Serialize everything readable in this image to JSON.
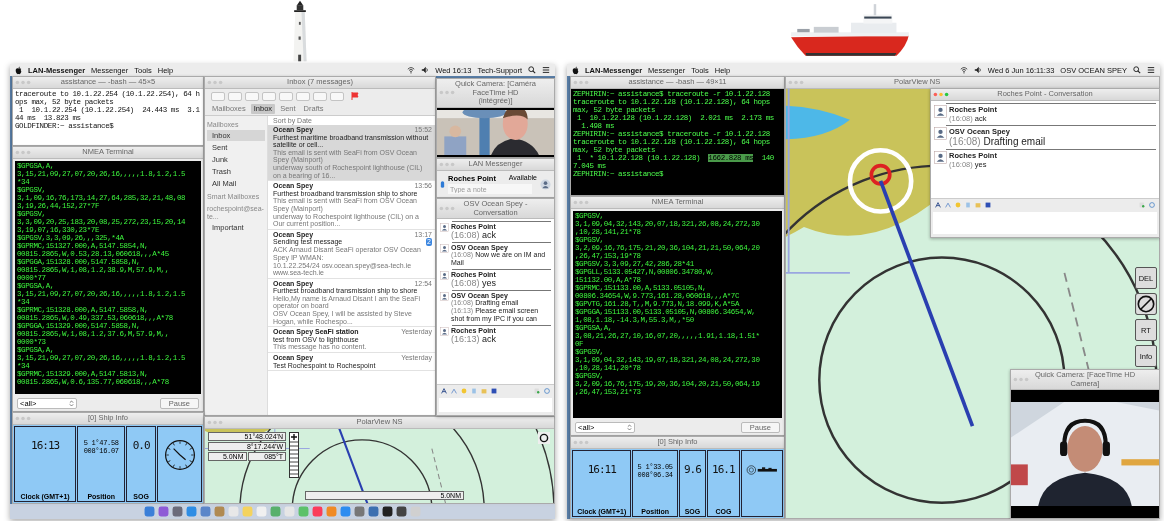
{
  "left_screen": {
    "menu_bar": {
      "app": "LAN-Messenger",
      "menus": [
        "Messenger",
        "Tools",
        "Help"
      ],
      "clock": "Wed 16:13",
      "user": "Tech-Support"
    },
    "terminal": {
      "title": "assistance — -bash — 45×5",
      "dark": false,
      "lines": [
        "traceroute to 10.1.22.254 (10.1.22.254), 64 h",
        "ops max, 52 byte packets",
        " 1  10.1.22.254 (10.1.22.254)  24.443 ms  3.1",
        "44 ms  13.823 ms",
        "GOLDFINDER:~ assistance$"
      ]
    },
    "nmea_terminal": {
      "title": "NMEA Terminal",
      "filter": "<all>",
      "button": "Pause",
      "lines": [
        "$GPGSA,A,",
        "3,15,21,09,27,07,20,26,16,,,,,1.8,1.2,1.5",
        "*34",
        "$GPGSV,",
        "3,1,09,16,76,173,14,27,64,285,32,21,48,08",
        "3,19,26,44,152,27*7F",
        "$GPGSV,",
        "3,3,09,20,25,183,20,08,25,272,23,15,20,14",
        "3,19,07,16,330,23*7E",
        "$GPGSV,3,3,09,26,,,325,*4A",
        "$GPRMC,151327.000,A,5147.5854,N,",
        "00815.2865,W,0.53,28.13,060618,,,A*45",
        "$GPGGA,151328.000,5147.5858,N,",
        "00815.2865,W,1,08,1.2,38.9,M,57.9,M,,",
        "0000*77",
        "$GPGSA,A,",
        "3,15,21,09,27,07,20,26,16,,,,,1.8,1.2,1.5",
        "*34",
        "$GPRMC,151328.000,A,5147.5858,N,",
        "00815.2865,W,0.49,337.53,060618,,,A*78",
        "$GPGGA,151329.000,5147.5858,N,",
        "00815.2865,W,1,08,1.2,37.6,M,57.9,M,,",
        "0000*73",
        "$GPGSA,A,",
        "3,15,21,09,27,07,20,26,16,,,,,1.8,1.2,1.5",
        "*34",
        "$GPRMC,151329.000,A,5147.5813,N,",
        "00815.2865,W,0.6,135.77,060618,,,A*78"
      ]
    },
    "mail": {
      "title": "Inbox (7 messages)",
      "tabs": [
        {
          "label": "Mailboxes",
          "selected": false
        },
        {
          "label": "Inbox",
          "selected": true
        },
        {
          "label": "Sent",
          "selected": false
        },
        {
          "label": "Drafts",
          "selected": false
        }
      ],
      "sidebar": {
        "heading": "Mailboxes",
        "items": [
          {
            "label": "Inbox",
            "selected": true
          },
          {
            "label": "Sent",
            "selected": false
          },
          {
            "label": "Junk",
            "selected": false
          },
          {
            "label": "Trash",
            "selected": false
          },
          {
            "label": "All Mail",
            "selected": false
          }
        ],
        "smart_heading": "Smart Mailboxes",
        "account": "rochespoint@sea-te...",
        "account_items": [
          {
            "label": "Important",
            "selected": false
          }
        ]
      },
      "sort": "Sort by Date",
      "messages": [
        {
          "sender": "Ocean Spey",
          "time": "15:52",
          "subject": "Furthest maritime broadband transmission without satellite or cell...",
          "preview": [
            "This email is sent with SeaFi from OSV Ocean Spey (Mainport)",
            "underway south of Rochespoint lighthouse (CIL) on a bearing of 16..."
          ],
          "selected": true
        },
        {
          "sender": "Ocean Spey",
          "time": "13:56",
          "subject": "Furthest broadband transmission ship to shore",
          "preview": [
            "This email is sent with SeaFi from OSV Ocean Spey (Mainport)",
            "underway to Rochespoint lighthouse (CIL) on a Our current position..."
          ],
          "selected": false
        },
        {
          "sender": "Ocean Spey",
          "time": "13:17",
          "subject": "Sending test message",
          "preview": [
            "ACK Arnaud Disant SeaFi operator OSV Ocean Spey IP WMAN:",
            "10.1.22.254/24 osv.ocean.spey@sea-tech.ie www.sea-tech.ie"
          ],
          "thread_count": "2",
          "selected": false
        },
        {
          "sender": "Ocean Spey",
          "time": "12:54",
          "subject": "Furthest broadband transmission ship to shore",
          "preview": [
            "Hello,My name is Arnaud Disant I am the SeaFi operator on board",
            "OSV Ocean Spey, I will be assisted by Steve Hogan, while Rochespo..."
          ],
          "selected": false
        },
        {
          "sender": "Ocean Spey SeaFi station",
          "time": "Yesterday",
          "subject": "test from OSV to lighthouse",
          "preview": [
            "This message has no content."
          ],
          "selected": false
        },
        {
          "sender": "Ocean Spey",
          "time": "Yesterday",
          "subject": "Test Rochespoint to Rochespoint",
          "selected": false
        }
      ]
    },
    "camera": {
      "title": "Quick Camera: [Caméra FaceTime HD (intégrée)]"
    },
    "messenger": {
      "title": "LAN Messenger",
      "contact": "Roches Point",
      "status": "Available",
      "note_placeholder": "Type a note"
    },
    "conversation": {
      "title": "OSV Ocean Spey - Conversation",
      "messages": [
        {
          "sender": "Roches Point",
          "lines": [
            {
              "time": "(16:08)",
              "text": "ack",
              "kind": "big"
            }
          ]
        },
        {
          "sender": "OSV Ocean Spey",
          "lines": [
            {
              "time": "(16:08)",
              "text": "Now we are on IM and Mail",
              "kind": "plain"
            }
          ]
        },
        {
          "sender": "Roches Point",
          "lines": [
            {
              "time": "(16:08)",
              "text": "yes",
              "kind": "big"
            }
          ]
        },
        {
          "sender": "OSV Ocean Spey",
          "lines": [
            {
              "time": "(16:08)",
              "text": "Drafting email",
              "kind": "plain"
            },
            {
              "time": "(16:13)",
              "text": "Please email screen shot from my IPC if you can",
              "kind": "plain"
            }
          ]
        },
        {
          "sender": "Roches Point",
          "lines": [
            {
              "time": "(16:13)",
              "text": "ack",
              "kind": "big"
            }
          ]
        }
      ]
    },
    "ship_info": {
      "title": "[0] Ship Info",
      "panels": [
        {
          "kind": "digits",
          "value": "16:13",
          "label": "Clock (GMT+1)"
        },
        {
          "kind": "position",
          "lines": [
            "5 1°47.58",
            "008°16.07"
          ],
          "label": "Position"
        },
        {
          "kind": "digits",
          "value": "0.0",
          "label": "SOG"
        },
        {
          "kind": "dial"
        }
      ]
    },
    "chart": {
      "title": "PolarView NS",
      "readouts": [
        "51°48.024'N",
        "8°17.244'W",
        "5.0NM",
        "085°T"
      ],
      "scale": "5.0NM"
    }
  },
  "right_screen": {
    "menu_bar": {
      "app": "LAN-Messenger",
      "menus": [
        "Messenger",
        "Tools",
        "Help"
      ],
      "clock": "Wed 6 Jun 16:11:33",
      "user": "OSV OCEAN SPEY"
    },
    "terminal": {
      "title": "assistance — -bash — 49×11",
      "dark": true,
      "lines": [
        "ZEPHIRIN:~ assistance$ traceroute -r 10.1.22.128",
        "traceroute to 10.1.22.128 (10.1.22.128), 64 hops",
        "max, 52 byte packets",
        " 1  10.1.22.128 (10.1.22.128)  2.021 ms  2.173 ms",
        "  1.498 ms",
        "ZEPHIRIN:~ assistance$ traceroute -r 10.1.22.128",
        "traceroute to 10.1.22.128 (10.1.22.128), 64 hops",
        "max, 52 byte packets",
        {
          "before": " 1  * 10.1.22.128 (10.1.22.128)  ",
          "highlight": "1662.828 ms",
          "after": "  140"
        },
        "7.045 ms",
        "ZEPHIRIN:~ assistance$"
      ]
    },
    "nmea_terminal": {
      "title": "NMEA Terminal",
      "filter": "<all>",
      "button": "Pause",
      "lines": [
        "$GPGSV,",
        "3,1,09,04,32,143,20,07,18,321,26,08,24,272,30",
        ",10,28,141,21*78",
        "$GPGSV,",
        "3,2,09,16,76,175,21,20,36,104,21,21,50,064,20",
        ",26,47,153,19*78",
        "$GPGSV,3,3,09,27,42,286,28*41",
        "$GPGLL,5133.05427,N,00806.34780,W,",
        "151132.00,A,A*78",
        "$GPRMC,151133.00,A,5133.05105,N,",
        "00806.34654,W,9.773,161.28,060618,,,A*7C",
        "$GPVTG,161.28,T,,M,9.773,N,18.099,K,A*5A",
        "$GPGGA,151133.00,5133.05105,N,00806.34654,W,",
        "1,08,1.18,-14.3,M,55.3,M,,*50",
        "$GPGSA,A,",
        "3,08,21,26,27,10,16,07,20,,,,,1.91,1.18,1.51*",
        "0F",
        "$GPGSV,",
        "3,1,09,04,32,143,19,07,18,321,24,08,24,272,30",
        ",10,28,141,20*78",
        "$GPGSV,",
        "3,2,09,16,76,175,19,20,36,104,20,21,50,064,19",
        ",26,47,153,21*73"
      ]
    },
    "ship_info": {
      "title": "[0] Ship Info",
      "panels": [
        {
          "kind": "digits",
          "value": "16:11",
          "label": "Clock (GMT+1)"
        },
        {
          "kind": "position",
          "lines": [
            "5 1°33.05",
            "008°06.34"
          ],
          "label": "Position"
        },
        {
          "kind": "digits",
          "value": "9.6",
          "label": "SOG"
        },
        {
          "kind": "digits",
          "value": "16.1",
          "label": "COG"
        },
        {
          "kind": "gauge"
        }
      ]
    },
    "chart": {
      "title": "PolarView NS",
      "buttons": [
        {
          "kind": "text",
          "label": "DEL"
        },
        {
          "kind": "compass"
        },
        {
          "kind": "text",
          "label": "RT"
        },
        {
          "kind": "text",
          "label": "Info"
        }
      ]
    },
    "conversation": {
      "title": "Roches Point - Conversation",
      "messages": [
        {
          "sender": "Roches Point",
          "lines": [
            {
              "time": "(16:08)",
              "text": "ack",
              "kind": "plain"
            }
          ]
        },
        {
          "sender": "OSV Ocean Spey",
          "lines": [
            {
              "time": "(16:08)",
              "text": "Drafting email",
              "kind": "big"
            }
          ]
        },
        {
          "sender": "Roches Point",
          "lines": [
            {
              "time": "(16:08)",
              "text": "yes",
              "kind": "plain"
            }
          ]
        }
      ]
    },
    "camera": {
      "title": "Quick Camera: [FaceTime HD Camera]"
    }
  }
}
